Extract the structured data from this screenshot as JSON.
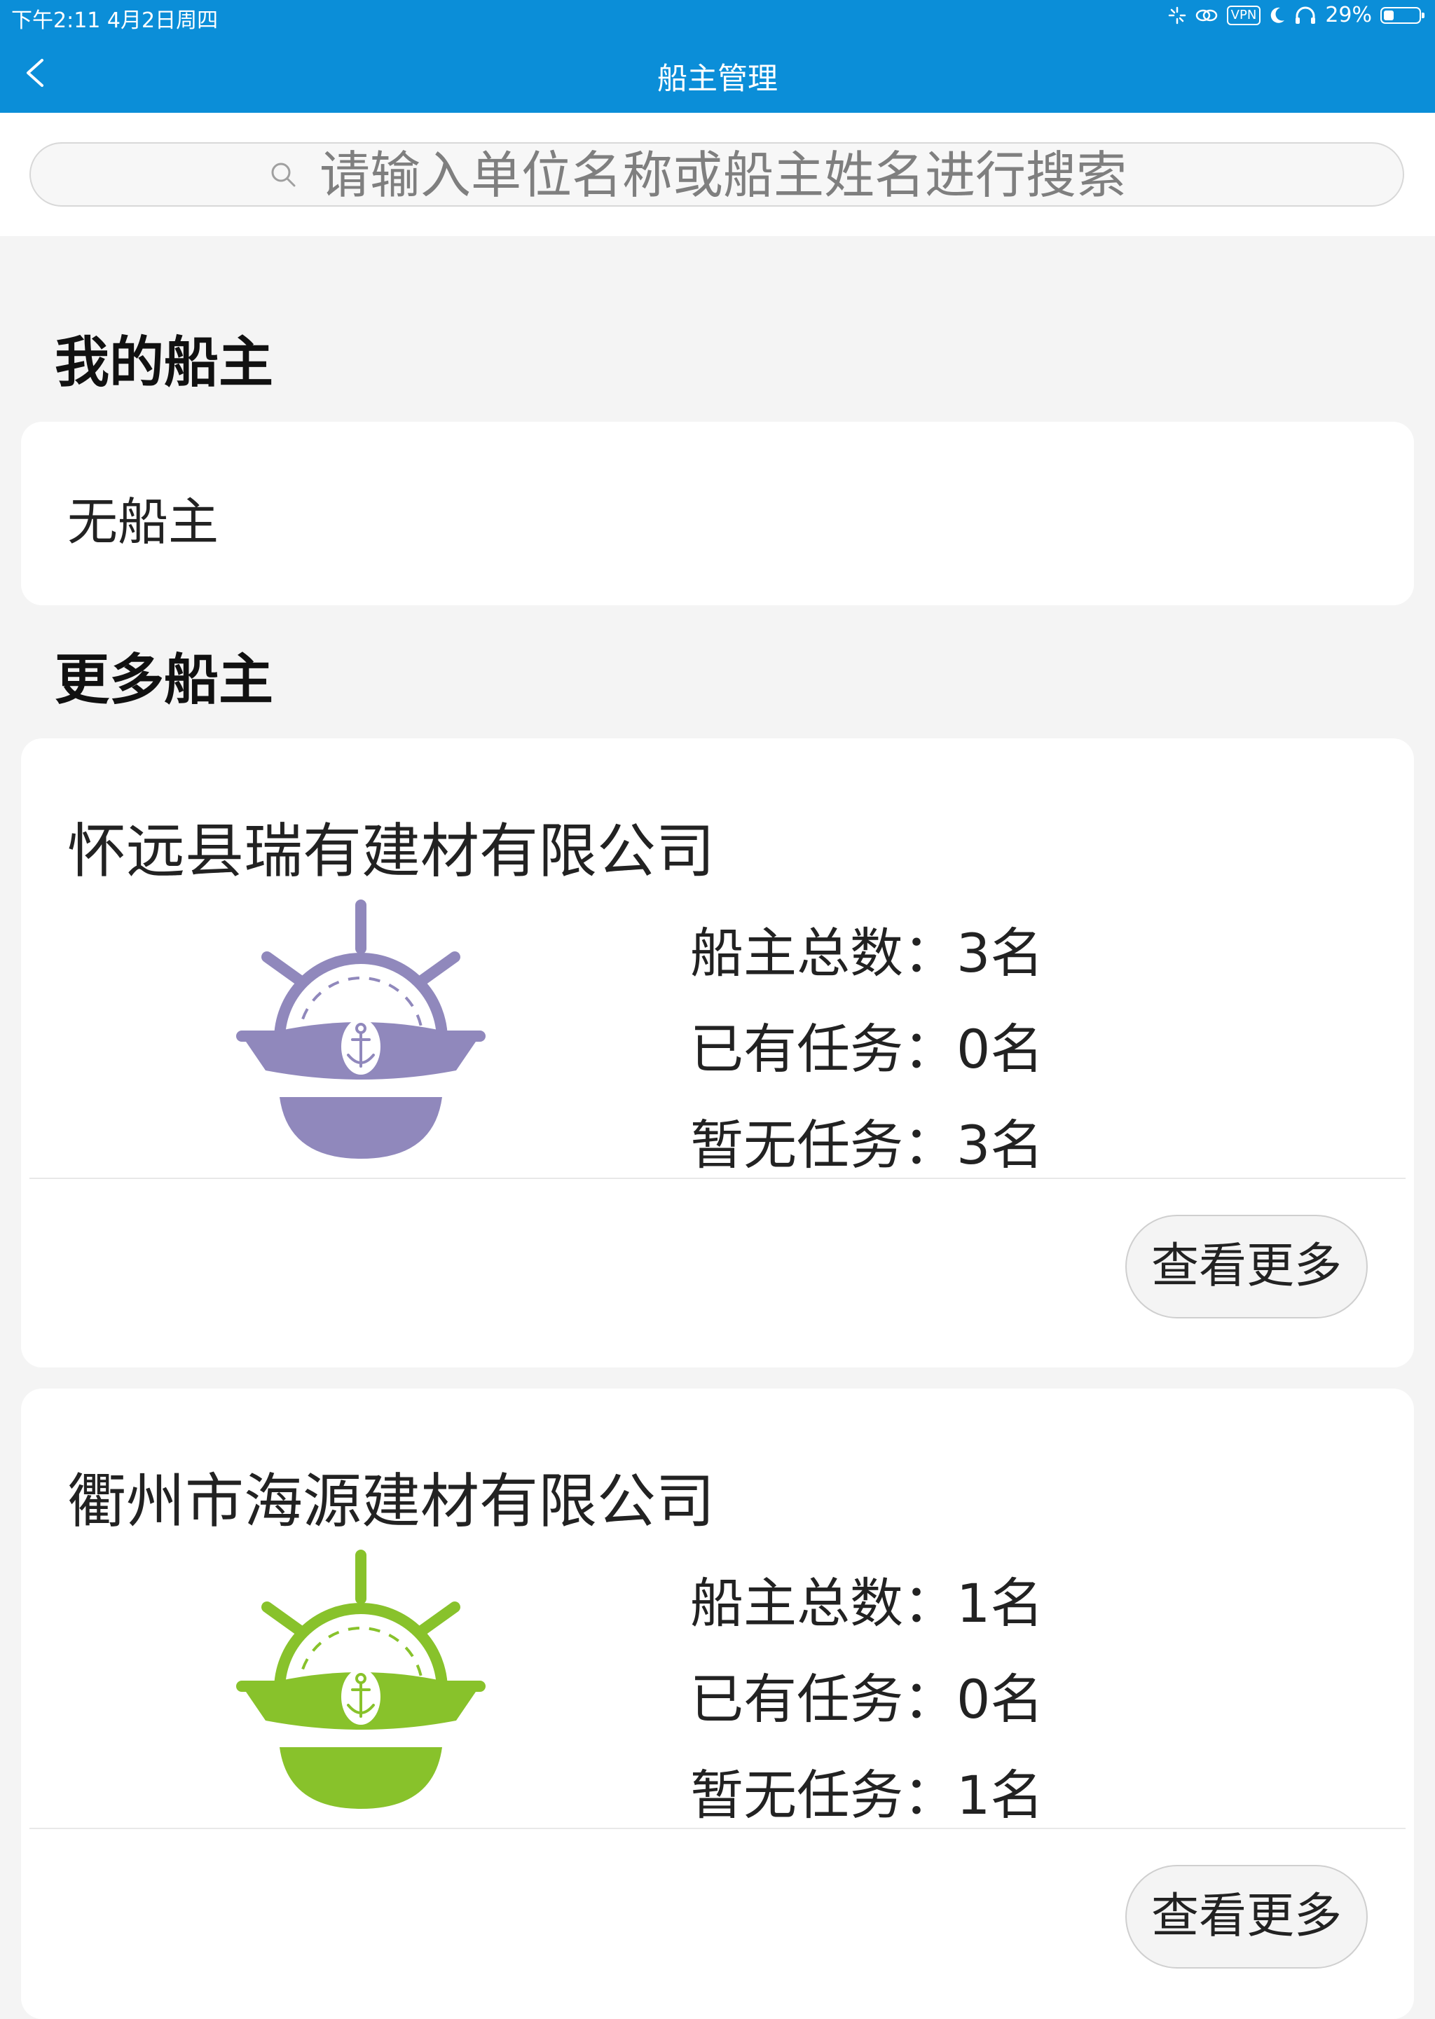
{
  "status_bar": {
    "time_date": "下午2:11   4月2日周四",
    "vpn": "VPN",
    "battery_text": "29%",
    "battery_level": 0.29
  },
  "nav": {
    "title": "船主管理"
  },
  "search": {
    "placeholder": "请输入单位名称或船主姓名进行搜索"
  },
  "my_section": {
    "title": "我的船主",
    "empty_text": "无船主"
  },
  "more_section": {
    "title": "更多船主"
  },
  "companies": [
    {
      "name": "怀远县瑞有建材有限公司",
      "total": "船主总数：3名",
      "with_task": "已有任务：0名",
      "no_task": "暂无任务：3名",
      "more_label": "查看更多",
      "icon": "ship-captain-icon",
      "icon_color": "#9088bc"
    },
    {
      "name": "衢州市海源建材有限公司",
      "total": "船主总数：1名",
      "with_task": "已有任务：0名",
      "no_task": "暂无任务：1名",
      "more_label": "查看更多",
      "icon": "ship-captain-icon",
      "icon_color": "#88c22b"
    }
  ],
  "colors": {
    "header": "#0b8ed8",
    "background": "#f4f4f4"
  }
}
